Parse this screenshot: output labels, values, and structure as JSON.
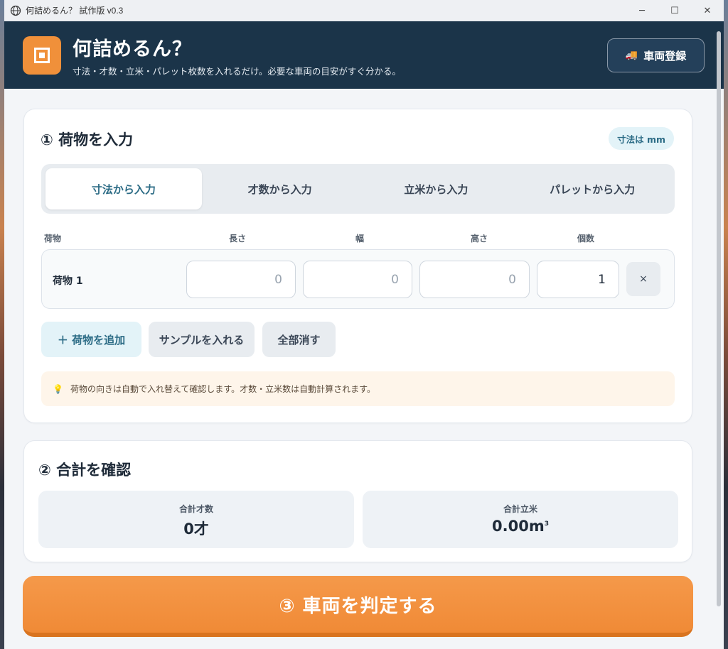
{
  "window": {
    "title": "何詰めるん？ 試作版 v0.3",
    "controls": [
      "─",
      "☐",
      "✕"
    ]
  },
  "header": {
    "title": "何詰めるん？",
    "subtitle": "寸法・才数・立米・パレット枚数を入れるだけ。必要な車両の目安がすぐ分かる。",
    "vehicle_button": "車両登録",
    "vehicle_icon": "🚚"
  },
  "section1": {
    "title": "① 荷物を入力",
    "unit_badge": "寸法は mm",
    "tabs": [
      {
        "label": "寸法から入力",
        "active": true
      },
      {
        "label": "才数から入力",
        "active": false
      },
      {
        "label": "立米から入力",
        "active": false
      },
      {
        "label": "パレットから入力",
        "active": false
      }
    ],
    "columns": {
      "item": "荷物",
      "length": "長さ",
      "width": "幅",
      "height": "高さ",
      "qty": "個数"
    },
    "items": [
      {
        "name": "荷物 1",
        "length": "0",
        "width": "0",
        "height": "0",
        "qty": "1",
        "remove": "×"
      }
    ],
    "add_button": "＋ 荷物を追加",
    "sample_button": "サンプルを入れる",
    "clear_button": "全部消す",
    "tip": "荷物の向きは自動で入れ替えて確認します。才数・立米数は自動計算されます。"
  },
  "section2": {
    "title": "② 合計を確認",
    "total_sai_label": "合計才数",
    "total_sai_value": "0才",
    "total_m3_label": "合計立米",
    "total_m3_value": "0.00m",
    "total_m3_unit_sup": "3"
  },
  "judge_button": "③ 車両を判定する"
}
